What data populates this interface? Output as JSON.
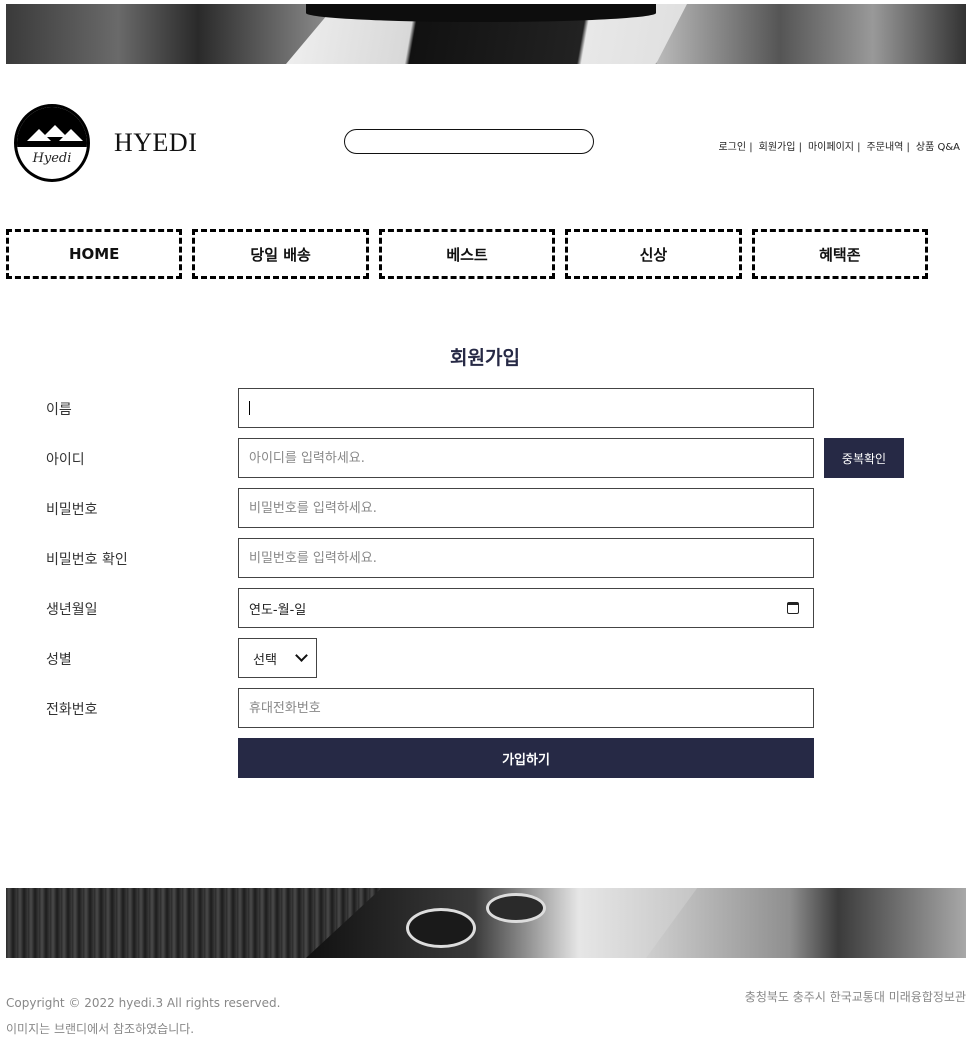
{
  "header": {
    "brand": "HYEDI",
    "logo_text": "Hyedi",
    "search": {
      "placeholder": "",
      "value": ""
    },
    "util_links": [
      "로그인 |",
      "회원가입 |",
      "마이페이지 |",
      "주문내역 |",
      "상품 Q&A"
    ]
  },
  "nav": {
    "items": [
      "HOME",
      "당일 배송",
      "베스트",
      "신상",
      "혜택존"
    ]
  },
  "form": {
    "title": "회원가입",
    "name_label": "이름",
    "name_value": "",
    "id_label": "아이디",
    "id_placeholder": "아이디를 입력하세요.",
    "dup_check_label": "중복확인",
    "pw_label": "비밀번호",
    "pw_placeholder": "비밀번호를 입력하세요.",
    "pw_confirm_label": "비밀번호 확인",
    "pw_confirm_placeholder": "비밀번호를 입력하세요.",
    "birth_label": "생년월일",
    "birth_value": "연도-월-일",
    "gender_label": "성별",
    "gender_selected": "선택",
    "phone_label": "전화번호",
    "phone_placeholder": "휴대전화번호",
    "submit_label": "가입하기"
  },
  "footer": {
    "copyright": "Copyright © 2022 hyedi.3 All rights reserved.",
    "image_note": "이미지는 브랜디에서 참조하였습니다.",
    "address": "충청북도 충주시 한국교통대 미래융합정보관"
  },
  "colors": {
    "accent": "#262945",
    "footer_text": "#888888"
  }
}
